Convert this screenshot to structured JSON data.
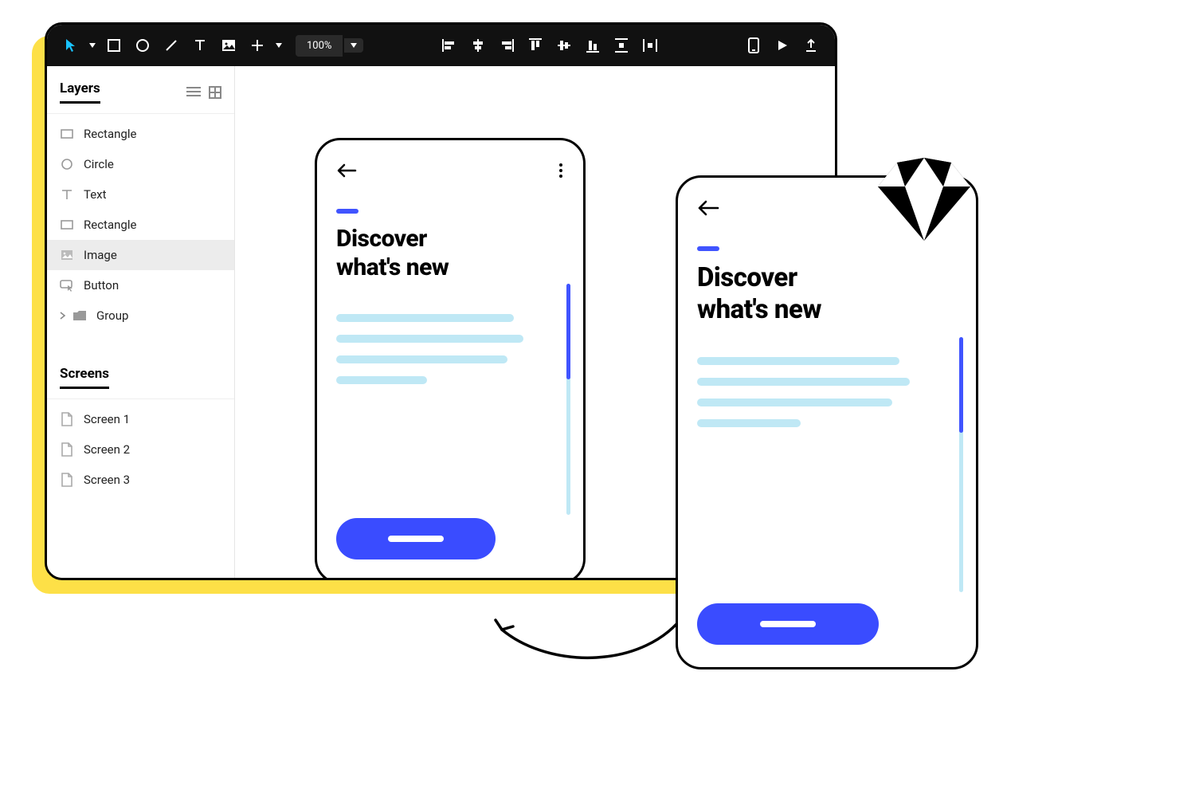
{
  "toolbar": {
    "zoom": "100%"
  },
  "sidebar": {
    "layers_title": "Layers",
    "screens_title": "Screens",
    "layers": [
      {
        "label": "Rectangle"
      },
      {
        "label": "Circle"
      },
      {
        "label": "Text"
      },
      {
        "label": "Rectangle"
      },
      {
        "label": "Image"
      },
      {
        "label": "Button"
      },
      {
        "label": "Group"
      }
    ],
    "screens": [
      {
        "label": "Screen 1"
      },
      {
        "label": "Screen 2"
      },
      {
        "label": "Screen 3"
      }
    ]
  },
  "artboard": {
    "headline_line1": "Discover",
    "headline_line2": "what's new"
  }
}
